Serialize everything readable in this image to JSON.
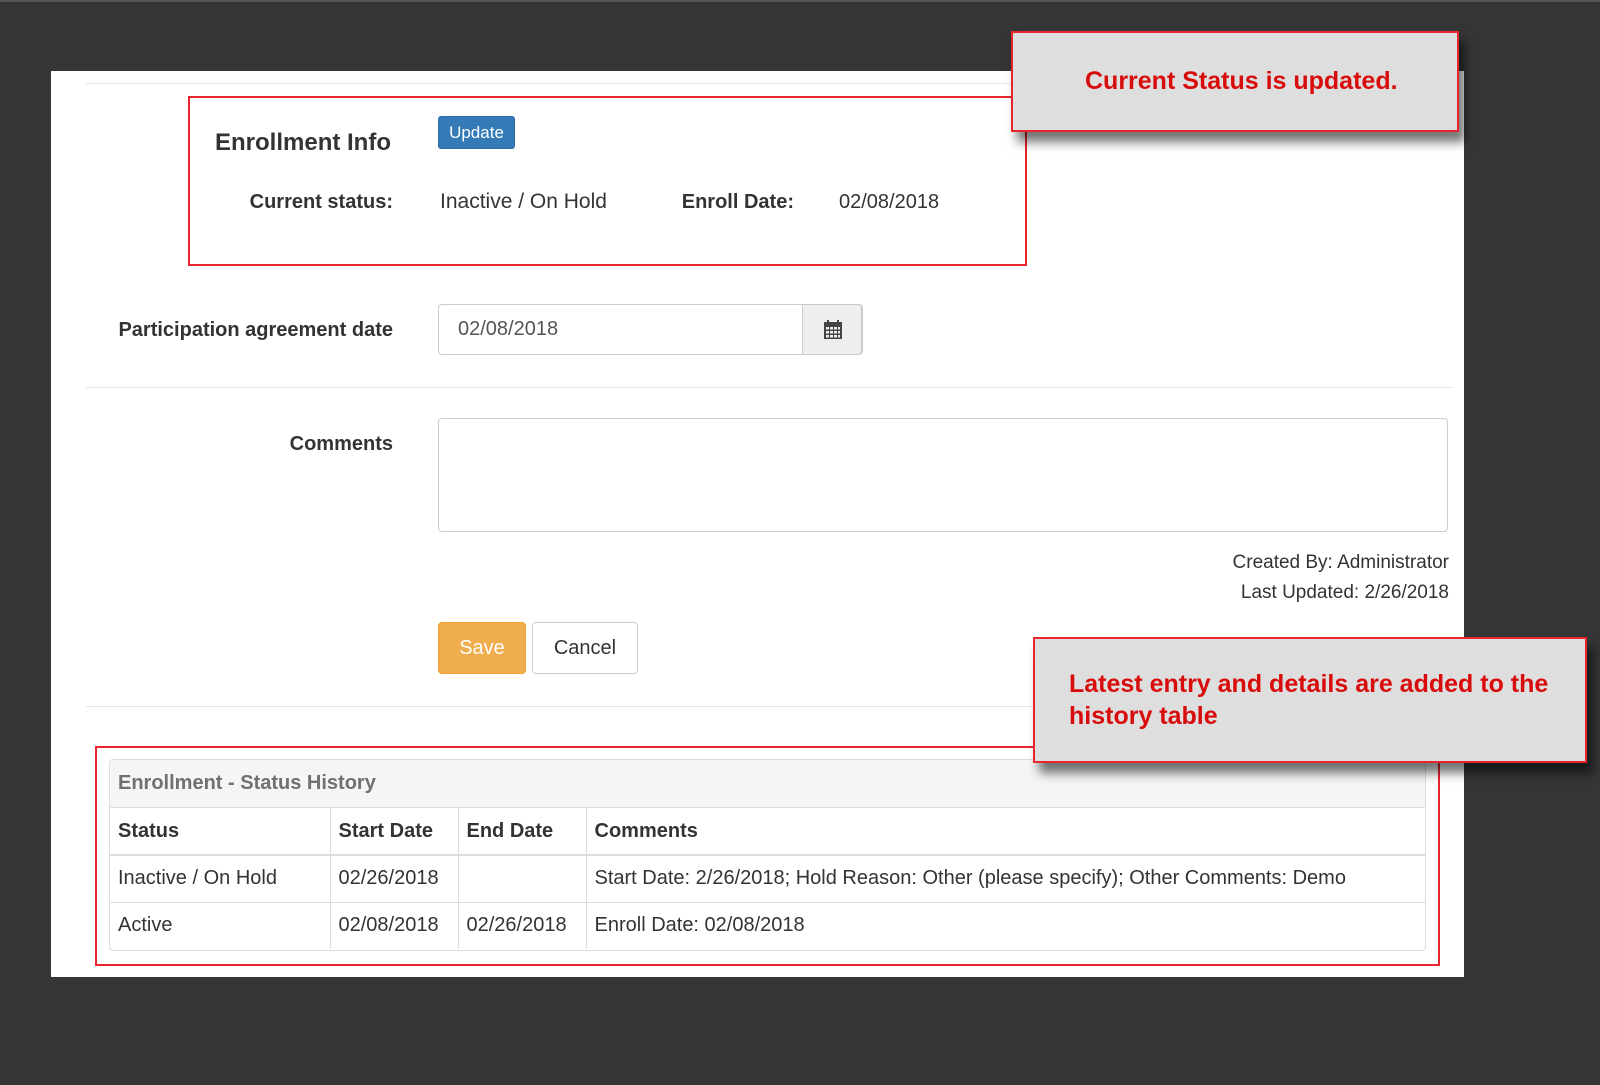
{
  "enrollment_info": {
    "title": "Enrollment Info",
    "update_label": "Update",
    "current_status_label": "Current status:",
    "current_status_value": "Inactive / On Hold",
    "enroll_date_label": "Enroll Date:",
    "enroll_date_value": "02/08/2018"
  },
  "participation": {
    "label": "Participation agreement date",
    "value": "02/08/2018",
    "icon": "calendar-icon"
  },
  "comments": {
    "label": "Comments",
    "value": ""
  },
  "meta": {
    "created_by": "Created By: Administrator",
    "last_updated": "Last Updated: 2/26/2018"
  },
  "actions": {
    "save_label": "Save",
    "cancel_label": "Cancel"
  },
  "history": {
    "title": "Enrollment - Status History",
    "columns": [
      "Status",
      "Start Date",
      "End Date",
      "Comments"
    ],
    "rows": [
      [
        "Inactive / On Hold",
        "02/26/2018",
        "",
        "Start Date: 2/26/2018; Hold Reason: Other (please specify); Other Comments: Demo"
      ],
      [
        "Active",
        "02/08/2018",
        "02/26/2018",
        "Enroll Date: 02/08/2018"
      ]
    ]
  },
  "callouts": {
    "status_updated": "Current Status is updated.",
    "history_added": "Latest entry and details are added to the history table"
  },
  "colors": {
    "background": "#353535",
    "highlight": "#e8252f",
    "callout_text": "#d90c0c",
    "update_button": "#337ab7",
    "save_button": "#f0ad4e"
  }
}
